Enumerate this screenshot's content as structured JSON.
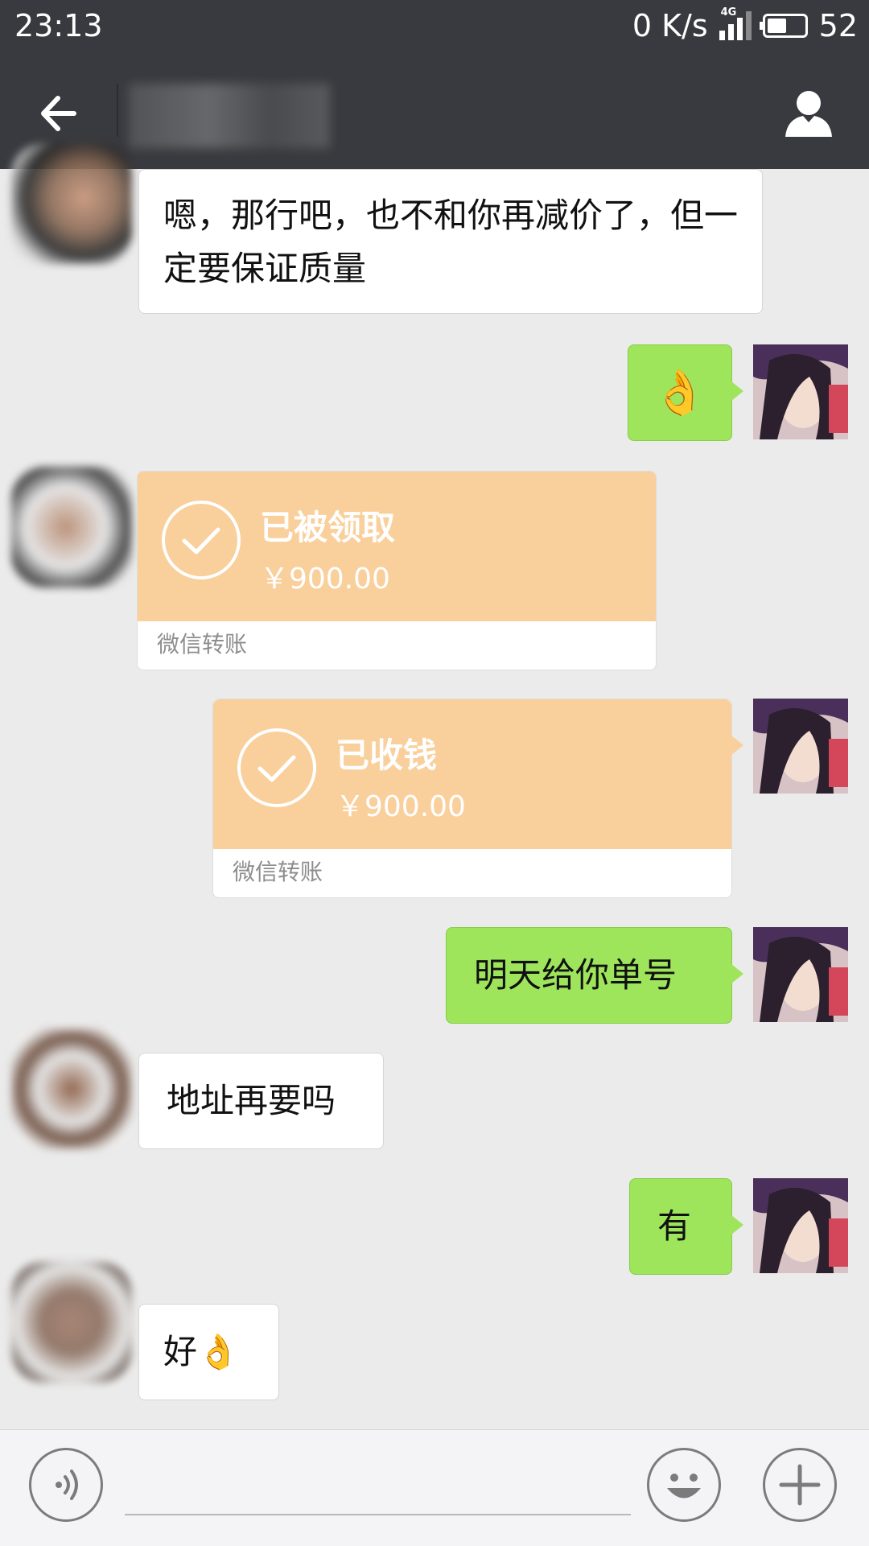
{
  "status_bar": {
    "time": "23:13",
    "net_speed": "0 K/s",
    "network_type": "4G",
    "battery": "52",
    "battery_fraction": 0.52
  },
  "header": {
    "back_icon": "arrow-left-icon",
    "profile_icon": "person-icon"
  },
  "messages": [
    {
      "side": "left",
      "type": "text",
      "text": "嗯，那行吧，也不和你再减价了，但一定要保证质量"
    },
    {
      "side": "right",
      "type": "emoji",
      "emoji": "👌"
    },
    {
      "side": "left",
      "type": "transfer",
      "status": "已被领取",
      "amount": "￥900.00",
      "footer": "微信转账"
    },
    {
      "side": "right",
      "type": "transfer",
      "status": "已收钱",
      "amount": "￥900.00",
      "footer": "微信转账"
    },
    {
      "side": "right",
      "type": "text",
      "text": "明天给你单号"
    },
    {
      "side": "left",
      "type": "text",
      "text": "地址再要吗"
    },
    {
      "side": "right",
      "type": "text",
      "text": "有"
    },
    {
      "side": "left",
      "type": "text",
      "text": "好",
      "emoji": "👌"
    }
  ],
  "colors": {
    "header_bg": "#393a3f",
    "chat_bg": "#ebebeb",
    "sent_bubble": "#9ee55c",
    "received_bubble": "#ffffff",
    "transfer_orange": "#f9cf9b"
  },
  "input_bar": {
    "voice_icon": "voice-icon",
    "emoji_icon": "smiley-icon",
    "plus_icon": "plus-icon",
    "value": ""
  }
}
